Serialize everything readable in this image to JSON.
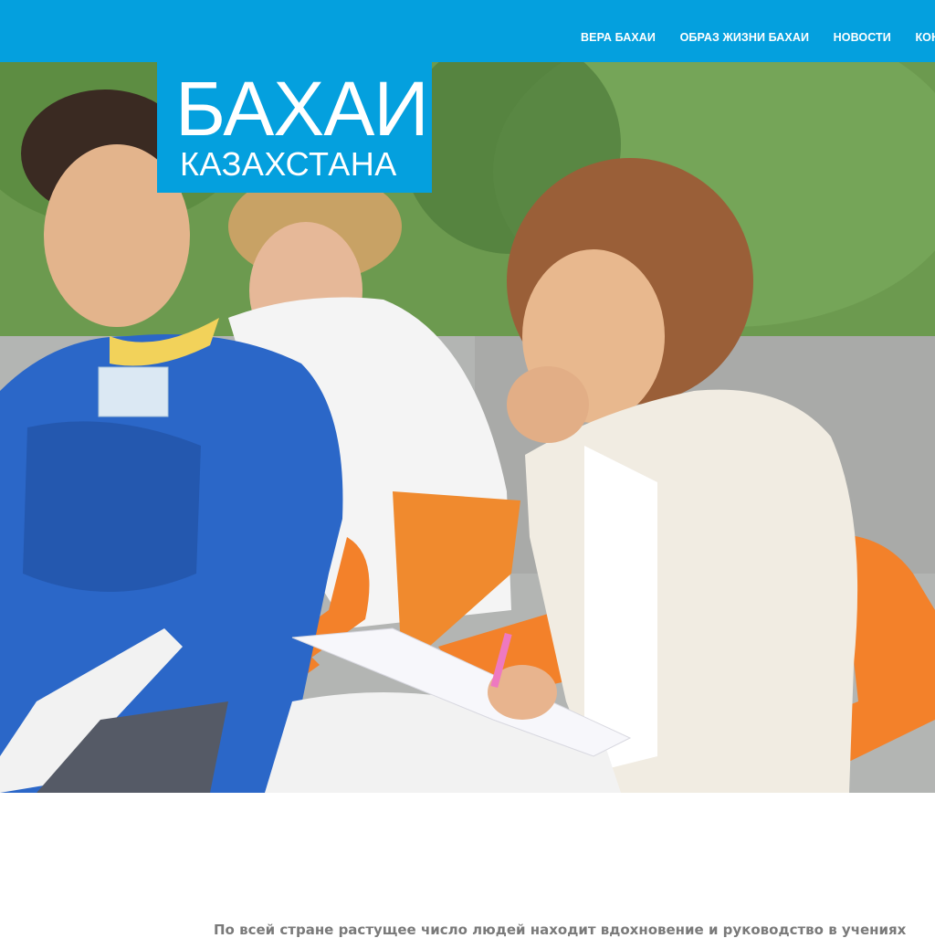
{
  "nav": {
    "items": [
      {
        "label": "ВЕРА БАХАИ"
      },
      {
        "label": "ОБРАЗ ЖИЗНИ БАХАИ"
      },
      {
        "label": "НОВОСТИ"
      },
      {
        "label": "КОНТАКТЫ"
      }
    ]
  },
  "logo": {
    "line1": "БАХАИ",
    "line2": "КАЗАХСТАНА"
  },
  "intro": {
    "text": "По всей стране растущее число людей находит вдохновение и руководство в учениях"
  },
  "colors": {
    "brand": "#04a0de",
    "text_muted": "#7a7a7a"
  }
}
